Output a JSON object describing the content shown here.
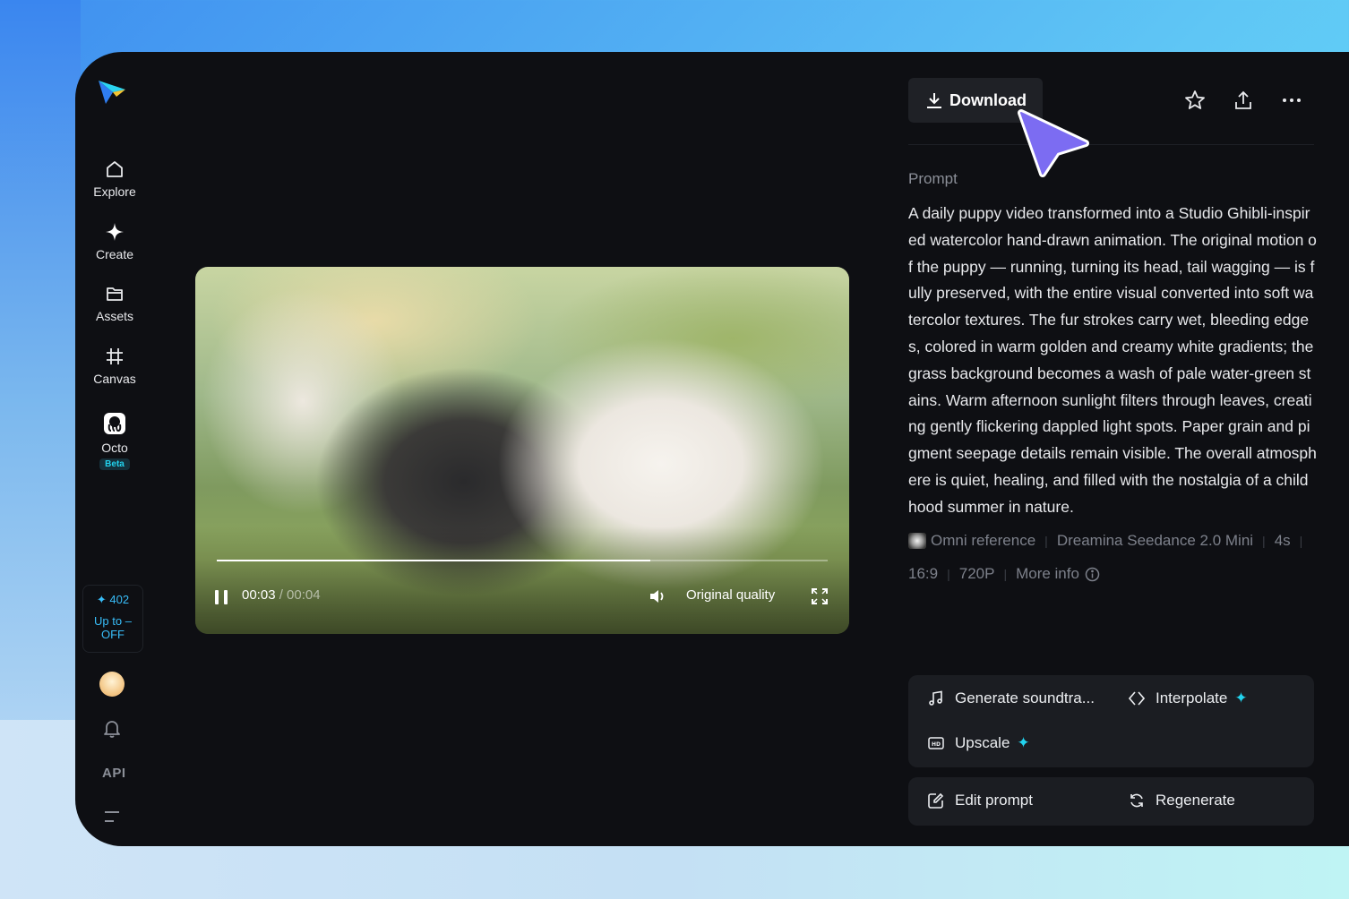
{
  "sidebar": {
    "items": [
      {
        "label": "Explore",
        "icon": "home-icon"
      },
      {
        "label": "Create",
        "icon": "sparkle-icon"
      },
      {
        "label": "Assets",
        "icon": "folder-icon"
      },
      {
        "label": "Canvas",
        "icon": "frame-icon"
      },
      {
        "label": "Octo",
        "icon": "octo-icon",
        "badge": "Beta"
      }
    ],
    "credits": {
      "count": "402",
      "promo_line1": "Up to –",
      "promo_line2": "OFF"
    },
    "api_label": "API"
  },
  "video": {
    "current_time": "00:03",
    "total_time": "/ 00:04",
    "progress": 0.71,
    "quality_label": "Original quality"
  },
  "panel": {
    "download_label": "Download",
    "prompt_label": "Prompt",
    "prompt_text": "A daily puppy video transformed into a Studio Ghibli-inspired watercolor hand-drawn animation. The original motion of the puppy — running, turning its head, tail wagging — is fully preserved, with the entire visual converted into soft watercolor textures. The fur strokes carry wet, bleeding edges, colored in warm golden and creamy white gradients; the grass background becomes a wash of pale water-green stains. Warm afternoon sunlight filters through leaves, creating gently flickering dappled light spots. Paper grain and pigment seepage details remain visible. The overall atmosphere is quiet, healing, and filled with the nostalgia of a childhood summer in nature.",
    "meta_row1": {
      "reference": "Omni reference",
      "model": "Dreamina Seedance 2.0 Mini",
      "duration": "4s"
    },
    "meta_row2": {
      "ratio": "16:9",
      "resolution": "720P",
      "more_info": "More info"
    },
    "actions": {
      "soundtrack": "Generate soundtra...",
      "interpolate": "Interpolate",
      "upscale": "Upscale",
      "edit_prompt": "Edit prompt",
      "regenerate": "Regenerate"
    }
  },
  "colors": {
    "accent": "#22d3ee",
    "app_bg": "#0e0f13",
    "card_bg": "#1b1d22",
    "cursor": "#7c6cf2"
  }
}
